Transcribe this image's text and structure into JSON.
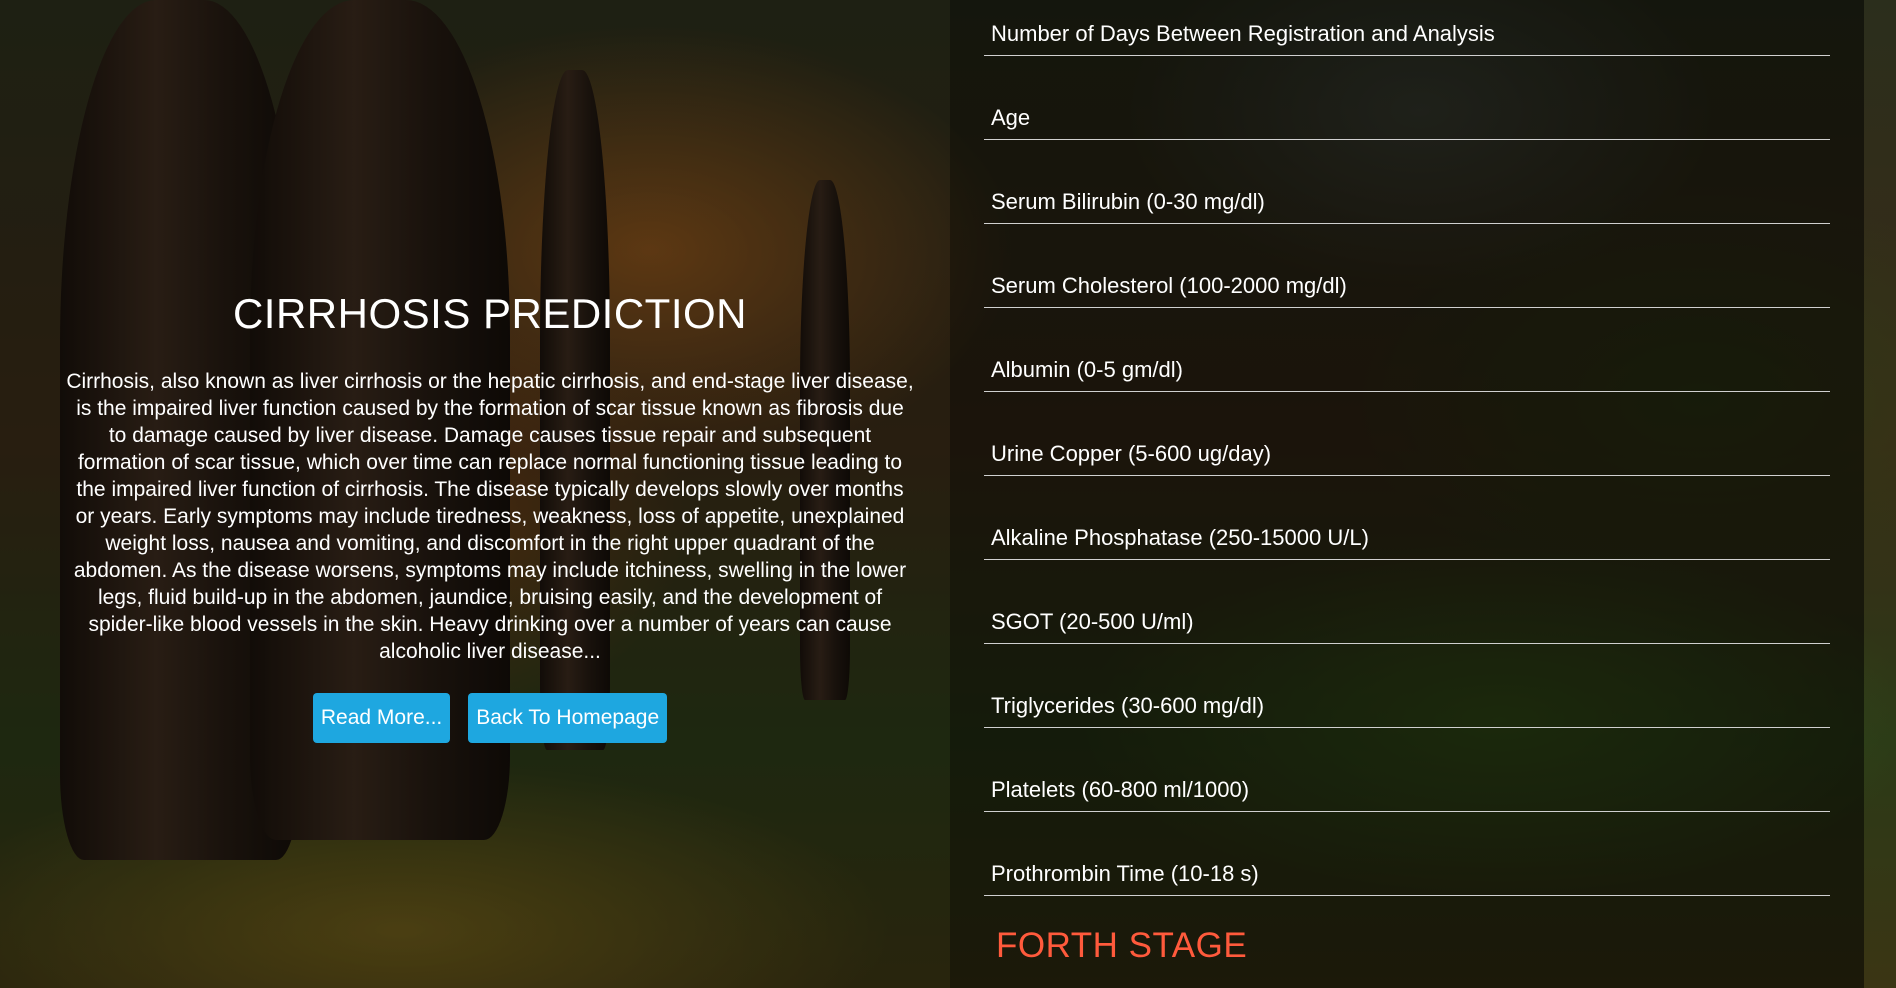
{
  "colors": {
    "button_bg": "#1ea7e0",
    "result_text": "#ff5a3c"
  },
  "info": {
    "title": "CIRRHOSIS PREDICTION",
    "description": "Cirrhosis, also known as liver cirrhosis or the hepatic cirrhosis, and end-stage liver disease, is the impaired liver function caused by the formation of scar tissue known as fibrosis due to damage caused by liver disease. Damage causes tissue repair and subsequent formation of scar tissue, which over time can replace normal functioning tissue leading to the impaired liver function of cirrhosis. The disease typically develops slowly over months or years. Early symptoms may include tiredness, weakness, loss of appetite, unexplained weight loss, nausea and vomiting, and discomfort in the right upper quadrant of the abdomen. As the disease worsens, symptoms may include itchiness, swelling in the lower legs, fluid build-up in the abdomen, jaundice, bruising easily, and the development of spider-like blood vessels in the skin. Heavy drinking over a number of years can cause alcoholic liver disease...",
    "read_more_label": "Read More...",
    "back_label": "Back To Homepage"
  },
  "form": {
    "fields": [
      {
        "placeholder": "Number of Days Between Registration and Analysis",
        "value": ""
      },
      {
        "placeholder": "Age",
        "value": ""
      },
      {
        "placeholder": "Serum Bilirubin (0-30 mg/dl)",
        "value": ""
      },
      {
        "placeholder": "Serum Cholesterol (100-2000 mg/dl)",
        "value": ""
      },
      {
        "placeholder": "Albumin (0-5 gm/dl)",
        "value": ""
      },
      {
        "placeholder": "Urine Copper (5-600 ug/day)",
        "value": ""
      },
      {
        "placeholder": "Alkaline Phosphatase (250-15000 U/L)",
        "value": ""
      },
      {
        "placeholder": "SGOT (20-500 U/ml)",
        "value": ""
      },
      {
        "placeholder": "Triglycerides (30-600 mg/dl)",
        "value": ""
      },
      {
        "placeholder": "Platelets (60-800 ml/1000)",
        "value": ""
      },
      {
        "placeholder": "Prothrombin Time (10-18 s)",
        "value": ""
      }
    ]
  },
  "result": {
    "text": "FORTH STAGE"
  }
}
